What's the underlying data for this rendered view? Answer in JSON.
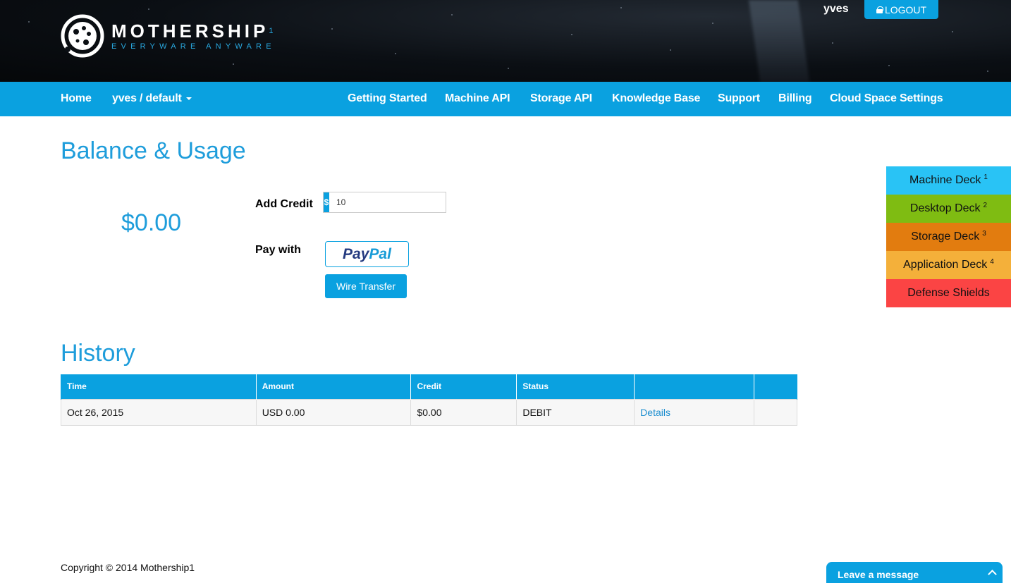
{
  "header": {
    "brand_name": "MOTHERSHIP",
    "brand_sup": "1",
    "tagline": "EVERYWARE ANYWARE",
    "username": "yves",
    "logout_label": "LOGOUT"
  },
  "nav": {
    "home": "Home",
    "space": "yves / default",
    "items": [
      "Getting Started",
      "Machine API",
      "Storage API",
      "Knowledge Base",
      "Support",
      "Billing",
      "Cloud Space Settings"
    ]
  },
  "balance": {
    "title": "Balance & Usage",
    "amount": "$0.00",
    "add_credit_label": "Add Credit",
    "currency_symbol": "$",
    "credit_value": "10",
    "pay_with_label": "Pay with",
    "paypal_part1": "Pay",
    "paypal_part2": "Pal",
    "wire_transfer_label": "Wire Transfer"
  },
  "side_tabs": [
    {
      "label": "Machine Deck",
      "num": "1",
      "color": "#29c3f5"
    },
    {
      "label": "Desktop Deck",
      "num": "2",
      "color": "#7fbc12"
    },
    {
      "label": "Storage Deck",
      "num": "3",
      "color": "#e27c0f"
    },
    {
      "label": "Application Deck",
      "num": "4",
      "color": "#f4b03a"
    },
    {
      "label": "Defense Shields",
      "num": "",
      "color": "#fb4444"
    }
  ],
  "history": {
    "title": "History",
    "columns": [
      "Time",
      "Amount",
      "Credit",
      "Status",
      "",
      ""
    ],
    "rows": [
      {
        "time": "Oct 26, 2015",
        "amount": "USD 0.00",
        "credit": "$0.00",
        "status": "DEBIT",
        "action": "Details"
      }
    ]
  },
  "footer": {
    "copyright": "Copyright © 2014 Mothership1"
  },
  "chat": {
    "label": "Leave a message"
  },
  "colors": {
    "accent": "#0aa1e0",
    "heading": "#1e9ddb"
  }
}
